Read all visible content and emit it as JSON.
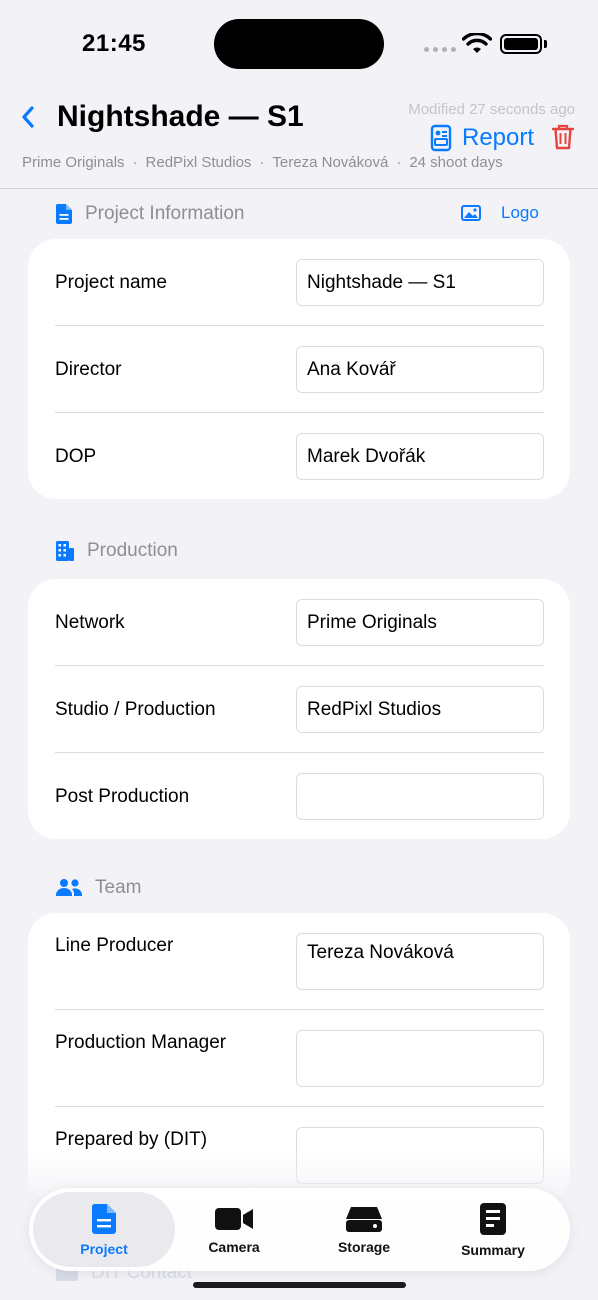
{
  "status": {
    "time": "21:45"
  },
  "header": {
    "title": "Nightshade — S1",
    "modified": "Modified 27 seconds ago",
    "report_label": "Report",
    "meta": [
      "Prime Originals",
      "RedPixl Studios",
      "Tereza Nováková",
      "24 shoot days"
    ]
  },
  "sections": {
    "project_info": {
      "title": "Project Information",
      "logo_label": "Logo",
      "rows": [
        {
          "label": "Project name",
          "value": "Nightshade — S1"
        },
        {
          "label": "Director",
          "value": "Ana Kovář"
        },
        {
          "label": "DOP",
          "value": "Marek Dvořák"
        }
      ]
    },
    "production": {
      "title": "Production",
      "rows": [
        {
          "label": "Network",
          "value": "Prime Originals"
        },
        {
          "label": "Studio / Production",
          "value": "RedPixl Studios"
        },
        {
          "label": "Post Production",
          "value": ""
        }
      ]
    },
    "team": {
      "title": "Team",
      "rows": [
        {
          "label": "Line Producer",
          "value": "Tereza Nováková"
        },
        {
          "label": "Production Manager",
          "value": ""
        },
        {
          "label": "Prepared by (DIT)",
          "value": ""
        }
      ]
    },
    "dit_contact": {
      "title": "DIT Contact"
    }
  },
  "tabs": [
    {
      "label": "Project",
      "icon": "document-icon",
      "active": true
    },
    {
      "label": "Camera",
      "icon": "video-camera-icon",
      "active": false
    },
    {
      "label": "Storage",
      "icon": "drive-icon",
      "active": false
    },
    {
      "label": "Summary",
      "icon": "summary-icon",
      "active": false
    }
  ],
  "colors": {
    "accent": "#0a7aff",
    "destructive": "#e5453b",
    "background": "#f2f2f7"
  }
}
